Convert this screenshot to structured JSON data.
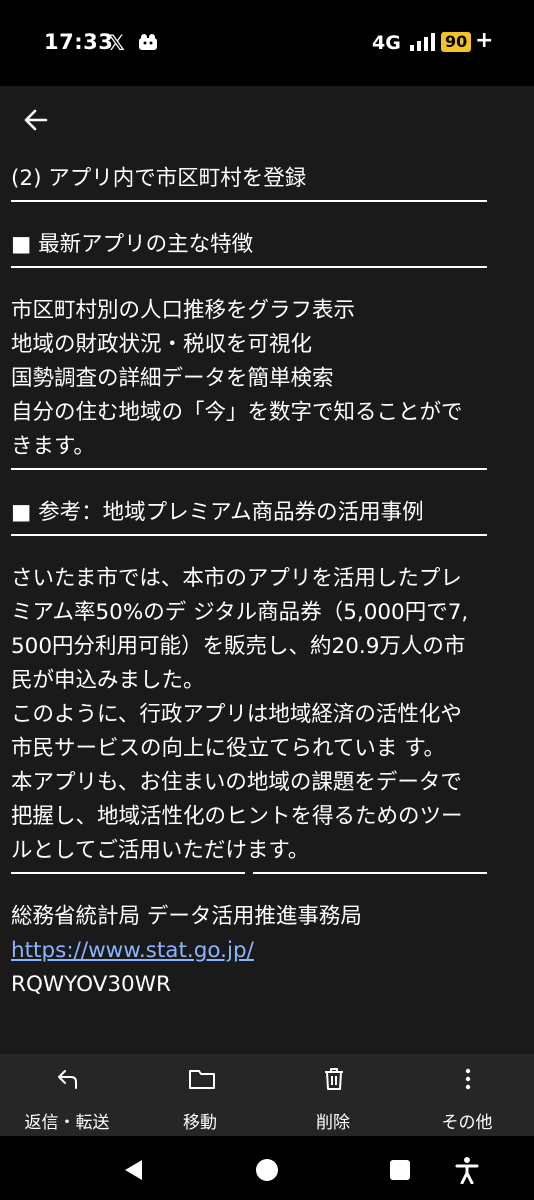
{
  "status": {
    "time": "17:33",
    "x_logo": "𝕏",
    "network": "4G",
    "battery": "90",
    "charging": "+"
  },
  "mail": {
    "lines": [
      "(2) アプリ内で市区町村を登録",
      "■ 最新アプリの主な特徴",
      "市区町村別の人口推移をグラフ表示",
      "地域の財政状況・税収を可視化",
      "国勢調査の詳細データを簡単検索",
      "自分の住む地域の「今」を数字で知ることがで",
      "きます。",
      "■ 参考：地域プレミアム商品券の活用事例",
      "さいたま市では、本市のアプリを活用したプレ",
      "ミアム率50%のデ ジタル商品券（5,000円で7,",
      "500円分利用可能）を販売し、約20.9万人の市",
      "民が申込みました。",
      "このように、行政アプリは地域経済の活性化や",
      "市民サービスの向上に役立てられていま す。",
      "本アプリも、お住まいの地域の課題をデータで",
      "把握し、地域活性化のヒントを得るためのツー",
      "ルとしてご活用いただけます。",
      "総務省統計局 データ活用推進事務局",
      "https://www.stat.go.jp/",
      "RQWYOV30WR"
    ]
  },
  "actions": {
    "reply": "返信・転送",
    "move": "移動",
    "delete": "削除",
    "more": "その他"
  }
}
